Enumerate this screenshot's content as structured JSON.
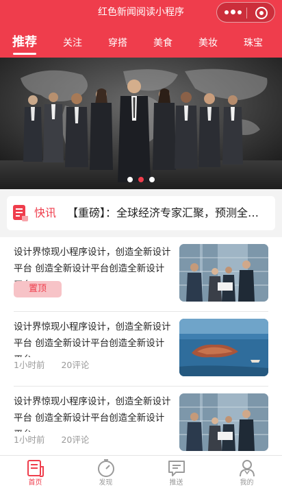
{
  "app": {
    "title": "红色新闻阅读小程序"
  },
  "capsule": {
    "more_icon": "more-dots-icon",
    "close_icon": "target-close-icon"
  },
  "tabs": [
    {
      "label": "推荐",
      "active": true
    },
    {
      "label": "关注",
      "active": false
    },
    {
      "label": "穿搭",
      "active": false
    },
    {
      "label": "美食",
      "active": false
    },
    {
      "label": "美妆",
      "active": false
    },
    {
      "label": "珠宝",
      "active": false
    }
  ],
  "banner": {
    "slide_count": 3,
    "active_slide": 2,
    "image": "business-team-world-map"
  },
  "flash": {
    "icon": "news-doc-icon",
    "label": "快讯",
    "text": "【重磅】：全球经济专家汇聚，预测全球经济新趋势"
  },
  "news": [
    {
      "title": "设计界惊现小程序设计，创造全新设计平台 创造全新设计平台创造全新设计平台",
      "pinned": true,
      "pin_label": "置顶",
      "image": "business-meeting-photo"
    },
    {
      "title": "设计界惊现小程序设计，创造全新设计平台 创造全新设计平台创造全新设计平台",
      "pinned": false,
      "time": "1小时前",
      "comments": "20评论",
      "image": "sea-island-boat-photo"
    },
    {
      "title": "设计界惊现小程序设计，创造全新设计平台 创造全新设计平台创造全新设计平台",
      "pinned": false,
      "time": "1小时前",
      "comments": "20评论",
      "image": "business-meeting-photo"
    }
  ],
  "tabbar": [
    {
      "label": "首页",
      "icon": "home-news-icon",
      "active": true
    },
    {
      "label": "发现",
      "icon": "stopwatch-icon",
      "active": false
    },
    {
      "label": "推送",
      "icon": "message-icon",
      "active": false
    },
    {
      "label": "我的",
      "icon": "user-icon",
      "active": false
    }
  ],
  "colors": {
    "primary": "#ef3d4c",
    "pin_bg": "#f7c3c7",
    "muted": "#999999"
  }
}
